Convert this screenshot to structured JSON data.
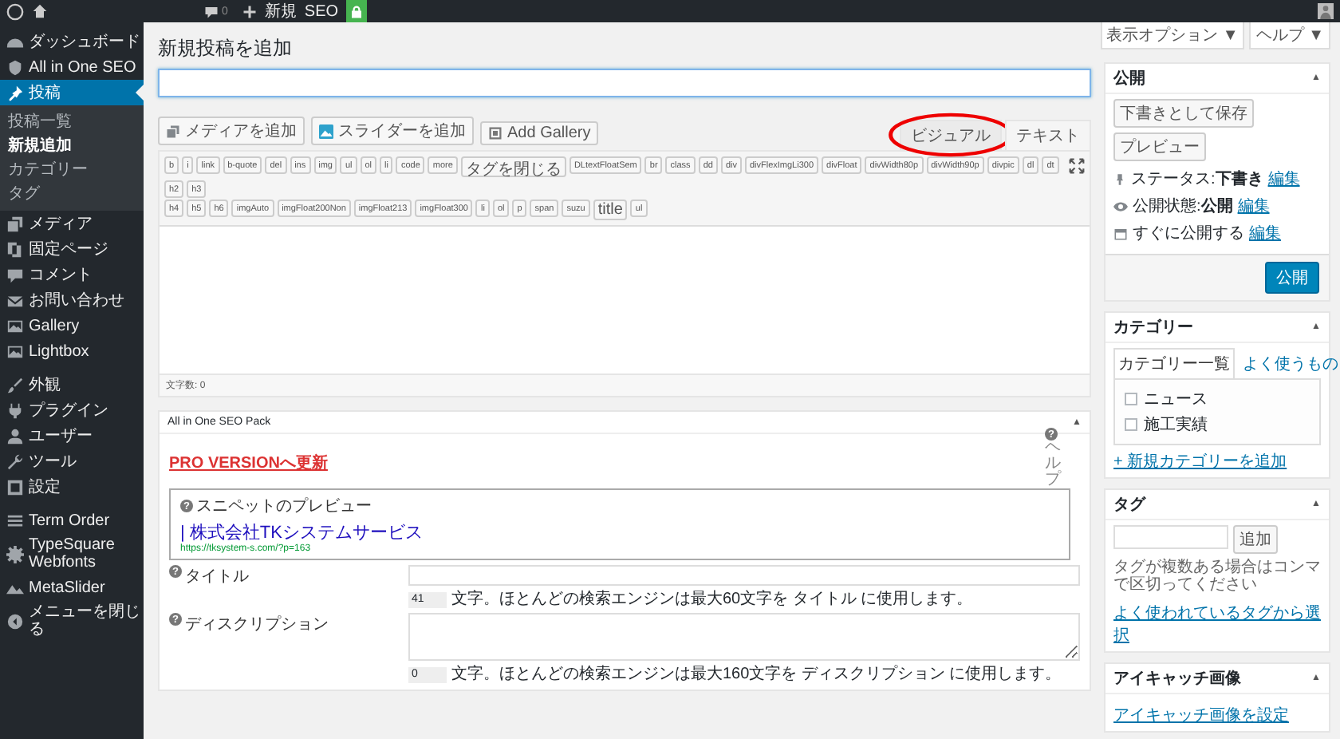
{
  "admin_bar": {
    "comments_count": "0",
    "new_label": "新規",
    "seo_label": "SEO"
  },
  "sidebar": {
    "groups": [
      [
        {
          "label": "ダッシュボード",
          "selected": false
        },
        {
          "label": "All in One SEO",
          "selected": false
        },
        {
          "label": "投稿",
          "selected": true,
          "children": [
            {
              "label": "投稿一覧",
              "selected": false
            },
            {
              "label": "新規追加",
              "selected": true
            },
            {
              "label": "カテゴリー",
              "selected": false
            },
            {
              "label": "タグ",
              "selected": false
            }
          ]
        },
        {
          "label": "メディア",
          "selected": false
        },
        {
          "label": "固定ページ",
          "selected": false
        },
        {
          "label": "コメント",
          "selected": false
        },
        {
          "label": "お問い合わせ",
          "selected": false
        },
        {
          "label": "Gallery",
          "selected": false
        },
        {
          "label": "Lightbox",
          "selected": false
        }
      ],
      [
        {
          "label": "外観",
          "selected": false
        },
        {
          "label": "プラグイン",
          "selected": false
        },
        {
          "label": "ユーザー",
          "selected": false
        },
        {
          "label": "ツール",
          "selected": false
        },
        {
          "label": "設定",
          "selected": false
        }
      ],
      [
        {
          "label": "Term Order",
          "selected": false
        },
        {
          "label": "TypeSquare Webfonts",
          "selected": false
        },
        {
          "label": "MetaSlider",
          "selected": false
        },
        {
          "label": "メニューを閉じる",
          "selected": false
        }
      ]
    ]
  },
  "screen_options": [
    "表示オプション ▼",
    "ヘルプ ▼"
  ],
  "page_title": "新規投稿を追加",
  "editor": {
    "media_buttons": [
      "メディアを追加",
      "スライダーを追加",
      "Add Gallery"
    ],
    "tabs": [
      {
        "label": "ビジュアル",
        "selected": false,
        "highlighted": true
      },
      {
        "label": "テキスト",
        "selected": true,
        "highlighted": false
      }
    ],
    "quicktags": [
      [
        "b",
        "i",
        "link",
        "b-quote",
        "del",
        "ins",
        "img",
        "ul",
        "ol",
        "li",
        "code",
        "more",
        "タグを閉じる",
        "DLtextFloatSem",
        "br",
        "class",
        "dd",
        "div",
        "divFlexImgLi300",
        "divFloat",
        "divWidth80p",
        "divWidth90p",
        "divpic",
        "dl",
        "dt",
        "h2",
        "h3"
      ],
      [
        "h4",
        "h5",
        "h6",
        "imgAuto",
        "imgFloat200Non",
        "imgFloat213",
        "imgFloat300",
        "li",
        "ol",
        "p",
        "span",
        "suzu",
        "title",
        "ul"
      ]
    ],
    "word_count": "文字数: 0"
  },
  "seo": {
    "title": "All in One SEO Pack",
    "toggle": "▲",
    "help": {
      "mark": "?",
      "label": "ヘルプ"
    },
    "pro_link": "PRO VERSIONへ更新",
    "snippet": {
      "help_mark": "?",
      "label": "スニペットのプレビュー",
      "title": "| 株式会社TKシステムサービス",
      "url": "https://tksystem-s.com/?p=163"
    },
    "fields": [
      {
        "kind": "input",
        "help_mark": "?",
        "label": "タイトル",
        "count": "41",
        "note": "文字。ほとんどの検索エンジンは最大60文字を タイトル に使用します。"
      },
      {
        "kind": "textarea",
        "help_mark": "?",
        "label": "ディスクリプション",
        "count": "0",
        "note": "文字。ほとんどの検索エンジンは最大160文字を ディスクリプション に使用します。"
      }
    ]
  },
  "publish": {
    "title": "公開",
    "toggle": "▲",
    "save_draft": "下書きとして保存",
    "preview": "プレビュー",
    "rows": [
      {
        "label": "ステータス:",
        "value": "下書き",
        "link": "編集"
      },
      {
        "label": "公開状態:",
        "value": "公開",
        "link": "編集"
      },
      {
        "label": "すぐに公開する",
        "link": "編集"
      }
    ],
    "publish_button": "公開"
  },
  "categories": {
    "title": "カテゴリー",
    "toggle": "▲",
    "tabs": [
      {
        "label": "カテゴリー一覧",
        "selected": true
      },
      {
        "label": "よく使うもの",
        "selected": false
      }
    ],
    "items": [
      {
        "label": "ニュース",
        "checked": false
      },
      {
        "label": "施工実績",
        "checked": false
      }
    ],
    "add_link": "+ 新規カテゴリーを追加"
  },
  "tags": {
    "title": "タグ",
    "toggle": "▲",
    "add_button": "追加",
    "hint": "タグが複数ある場合はコンマで区切ってください",
    "choose_link": "よく使われているタグから選択"
  },
  "featured_image": {
    "title": "アイキャッチ画像",
    "toggle": "▲",
    "set_link": "アイキャッチ画像を設定"
  }
}
